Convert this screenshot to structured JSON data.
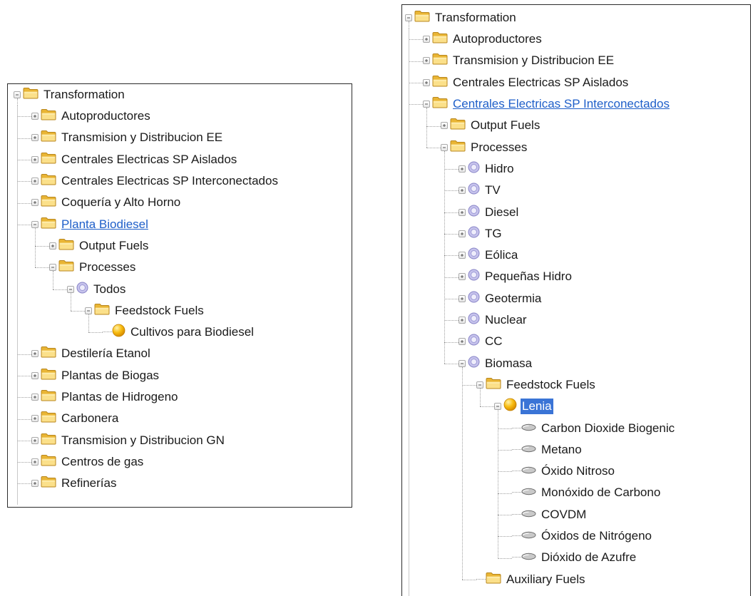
{
  "icons": {
    "folder": "folder-icon",
    "process": "process-gear-icon",
    "fuel": "fuel-ball-icon",
    "effect": "emission-pill-icon",
    "toggle_expanded": "collapse-minus-icon",
    "toggle_collapsed": "expand-plus-icon"
  },
  "colors": {
    "link": "#1f5fc9",
    "selection": "#3a74d6",
    "folder": "#f2c34a",
    "fuel": "#f7b600"
  },
  "left_tree": [
    {
      "label": "Transformation",
      "level": 0,
      "icon": "folder",
      "toggle": "expanded"
    },
    {
      "label": "Autoproductores",
      "level": 1,
      "icon": "folder",
      "toggle": "collapsed"
    },
    {
      "label": "Transmision y Distribucion EE",
      "level": 1,
      "icon": "folder",
      "toggle": "collapsed"
    },
    {
      "label": "Centrales Electricas SP Aislados",
      "level": 1,
      "icon": "folder",
      "toggle": "collapsed"
    },
    {
      "label": "Centrales Electricas SP Interconectados",
      "level": 1,
      "icon": "folder",
      "toggle": "collapsed"
    },
    {
      "label": "Coquería y Alto Horno",
      "level": 1,
      "icon": "folder",
      "toggle": "collapsed"
    },
    {
      "label": "Planta Biodiesel",
      "level": 1,
      "icon": "folder",
      "toggle": "expanded",
      "style": "link"
    },
    {
      "label": "Output Fuels",
      "level": 2,
      "icon": "folder",
      "toggle": "collapsed"
    },
    {
      "label": "Processes",
      "level": 2,
      "icon": "folder",
      "toggle": "expanded"
    },
    {
      "label": "Todos",
      "level": 3,
      "icon": "process",
      "toggle": "expanded"
    },
    {
      "label": "Feedstock Fuels",
      "level": 4,
      "icon": "folder",
      "toggle": "expanded"
    },
    {
      "label": "Cultivos para Biodiesel",
      "level": 5,
      "icon": "fuel",
      "toggle": "none"
    },
    {
      "label": "Destilería Etanol",
      "level": 1,
      "icon": "folder",
      "toggle": "collapsed"
    },
    {
      "label": "Plantas de Biogas",
      "level": 1,
      "icon": "folder",
      "toggle": "collapsed"
    },
    {
      "label": "Plantas de Hidrogeno",
      "level": 1,
      "icon": "folder",
      "toggle": "collapsed"
    },
    {
      "label": "Carbonera",
      "level": 1,
      "icon": "folder",
      "toggle": "collapsed"
    },
    {
      "label": "Transmision y Distribucion GN",
      "level": 1,
      "icon": "folder",
      "toggle": "collapsed"
    },
    {
      "label": "Centros de gas",
      "level": 1,
      "icon": "folder",
      "toggle": "collapsed"
    },
    {
      "label": "Refinerías",
      "level": 1,
      "icon": "folder",
      "toggle": "collapsed"
    }
  ],
  "right_tree": [
    {
      "label": "Transformation",
      "level": 0,
      "icon": "folder",
      "toggle": "expanded"
    },
    {
      "label": "Autoproductores",
      "level": 1,
      "icon": "folder",
      "toggle": "collapsed"
    },
    {
      "label": "Transmision y Distribucion EE",
      "level": 1,
      "icon": "folder",
      "toggle": "collapsed"
    },
    {
      "label": "Centrales Electricas SP Aislados",
      "level": 1,
      "icon": "folder",
      "toggle": "collapsed"
    },
    {
      "label": "Centrales Electricas SP Interconectados",
      "level": 1,
      "icon": "folder",
      "toggle": "expanded",
      "style": "link"
    },
    {
      "label": "Output Fuels",
      "level": 2,
      "icon": "folder",
      "toggle": "collapsed"
    },
    {
      "label": "Processes",
      "level": 2,
      "icon": "folder",
      "toggle": "expanded"
    },
    {
      "label": "Hidro",
      "level": 3,
      "icon": "process",
      "toggle": "collapsed"
    },
    {
      "label": "TV",
      "level": 3,
      "icon": "process",
      "toggle": "collapsed"
    },
    {
      "label": "Diesel",
      "level": 3,
      "icon": "process",
      "toggle": "collapsed"
    },
    {
      "label": "TG",
      "level": 3,
      "icon": "process",
      "toggle": "collapsed"
    },
    {
      "label": "Eólica",
      "level": 3,
      "icon": "process",
      "toggle": "collapsed"
    },
    {
      "label": "Pequeñas Hidro",
      "level": 3,
      "icon": "process",
      "toggle": "collapsed"
    },
    {
      "label": "Geotermia",
      "level": 3,
      "icon": "process",
      "toggle": "collapsed"
    },
    {
      "label": "Nuclear",
      "level": 3,
      "icon": "process",
      "toggle": "collapsed"
    },
    {
      "label": "CC",
      "level": 3,
      "icon": "process",
      "toggle": "collapsed"
    },
    {
      "label": "Biomasa",
      "level": 3,
      "icon": "process",
      "toggle": "expanded"
    },
    {
      "label": "Feedstock Fuels",
      "level": 4,
      "icon": "folder",
      "toggle": "expanded"
    },
    {
      "label": "Lenia",
      "level": 5,
      "icon": "fuel",
      "toggle": "expanded",
      "style": "selected"
    },
    {
      "label": "Carbon Dioxide Biogenic",
      "level": 6,
      "icon": "effect",
      "toggle": "none"
    },
    {
      "label": "Metano",
      "level": 6,
      "icon": "effect",
      "toggle": "none"
    },
    {
      "label": "Óxido Nitroso",
      "level": 6,
      "icon": "effect",
      "toggle": "none"
    },
    {
      "label": "Monóxido de Carbono",
      "level": 6,
      "icon": "effect",
      "toggle": "none"
    },
    {
      "label": "COVDM",
      "level": 6,
      "icon": "effect",
      "toggle": "none"
    },
    {
      "label": "Óxidos de Nitrógeno",
      "level": 6,
      "icon": "effect",
      "toggle": "none"
    },
    {
      "label": "Dióxido de Azufre",
      "level": 6,
      "icon": "effect",
      "toggle": "none"
    },
    {
      "label": "Auxiliary Fuels",
      "level": 4,
      "icon": "folder",
      "toggle": "none"
    }
  ]
}
